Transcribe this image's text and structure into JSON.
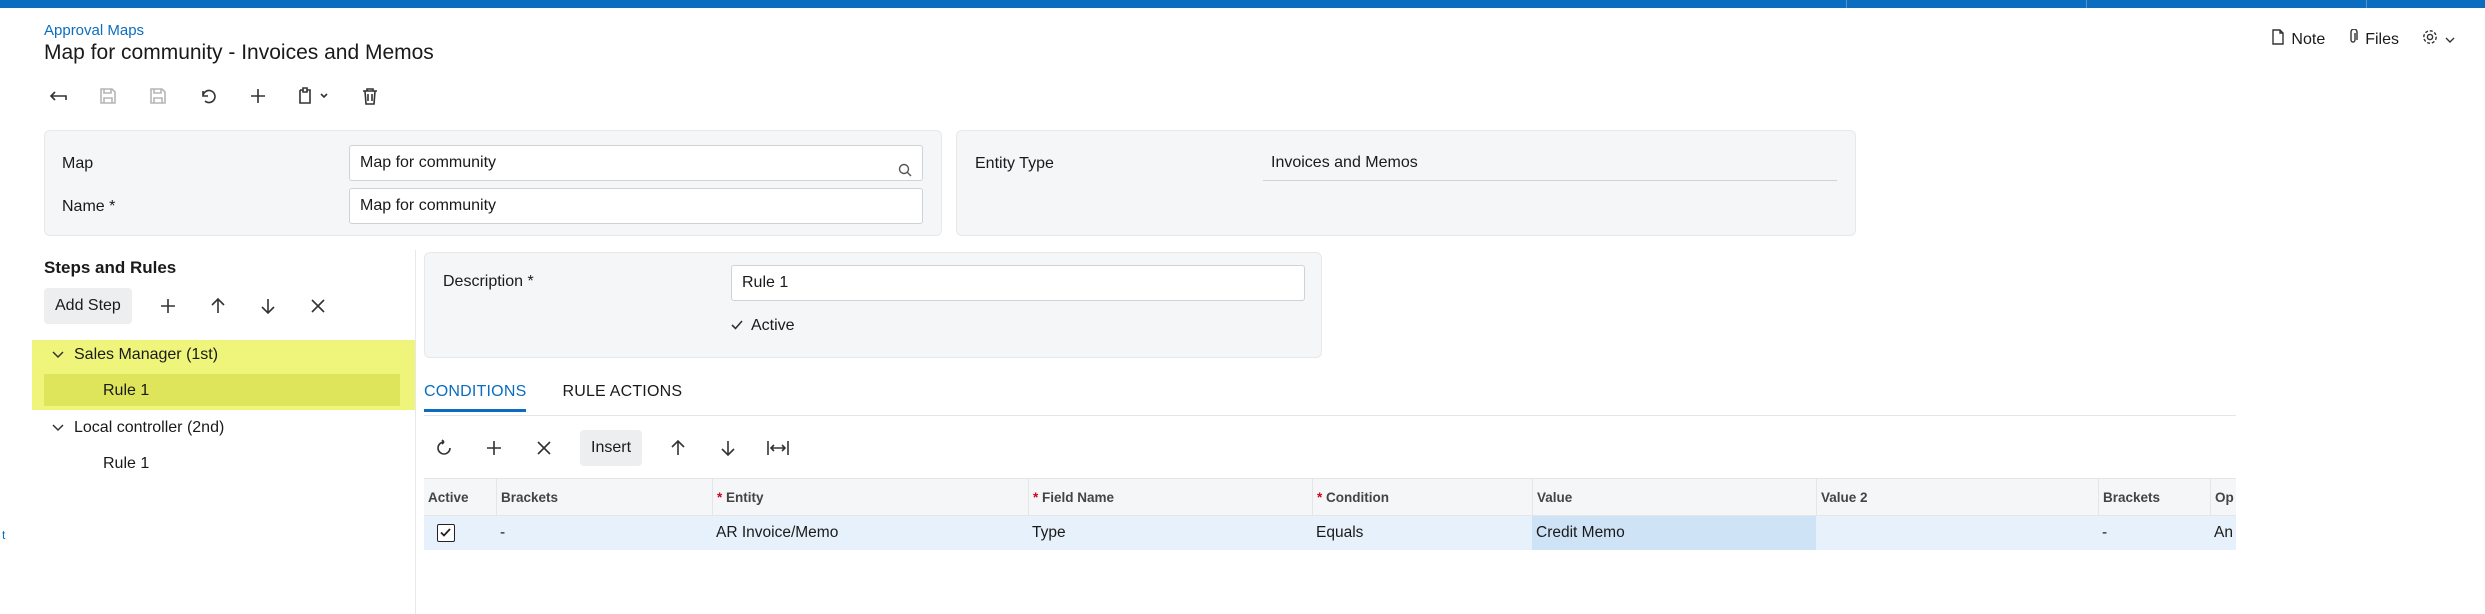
{
  "header": {
    "breadcrumb": "Approval Maps",
    "title": "Map for community - Invoices and Memos",
    "actions": [
      {
        "label": "Note",
        "icon": "note-icon"
      },
      {
        "label": "Files",
        "icon": "paperclip-icon"
      }
    ]
  },
  "summary": {
    "map_label": "Map",
    "map_value": "Map for community",
    "name_label": "Name *",
    "name_value": "Map for community",
    "entity_type_label": "Entity Type",
    "entity_type_value": "Invoices and Memos"
  },
  "steps": {
    "title": "Steps and Rules",
    "add_step_label": "Add Step",
    "tree": [
      {
        "label": "Sales Manager (1st)",
        "rules": [
          "Rule 1"
        ]
      },
      {
        "label": "Local controller (2nd)",
        "rules": [
          "Rule 1"
        ]
      }
    ]
  },
  "rule": {
    "description_label": "Description *",
    "description_value": "Rule 1",
    "active_label": "Active"
  },
  "tabs": [
    {
      "label": "CONDITIONS",
      "active": true
    },
    {
      "label": "RULE ACTIONS",
      "active": false
    }
  ],
  "grid_toolbar": {
    "insert_label": "Insert"
  },
  "grid": {
    "columns": [
      "Active",
      "Brackets",
      "Entity",
      "Field Name",
      "Condition",
      "Value",
      "Value 2",
      "Brackets",
      "Op"
    ],
    "required_mark": "*",
    "rows": [
      {
        "active": true,
        "brackets": "-",
        "entity": "AR Invoice/Memo",
        "field_name": "Type",
        "condition": "Equals",
        "value": "Credit Memo",
        "value2": "",
        "brackets2": "-",
        "operator": "An"
      }
    ]
  },
  "colors": {
    "accent": "#0b6dbf",
    "tree_highlight": "#eff57a",
    "tree_selected": "#dfe55a",
    "row_selected": "#e6f1fb"
  }
}
